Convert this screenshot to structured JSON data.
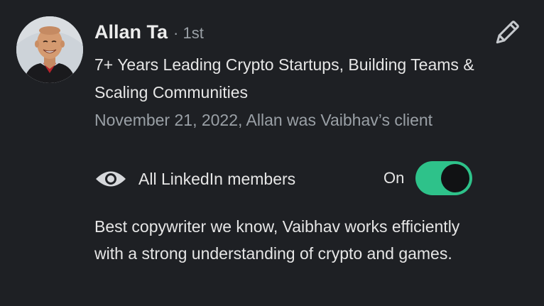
{
  "recommendation": {
    "author": {
      "name": "Allan Ta",
      "degree": "· 1st",
      "headline": "7+ Years Leading Crypto Startups, Building Teams & Scaling Communities",
      "avatar_icon": "profile-photo"
    },
    "meta": "November 21, 2022, Allan was Vaibhav’s client",
    "visibility": {
      "icon": "eye-icon",
      "label": "All LinkedIn members"
    },
    "toggle": {
      "label": "On",
      "state": true,
      "color": "#2ec28a"
    },
    "edit_icon": "pencil-icon",
    "text": "Best copywriter we know, Vaibhav works efficiently with a strong understanding of crypto and games."
  },
  "theme": {
    "background": "#1e2024",
    "secondary_text": "#9aa0a6",
    "accent": "#2ec28a"
  }
}
